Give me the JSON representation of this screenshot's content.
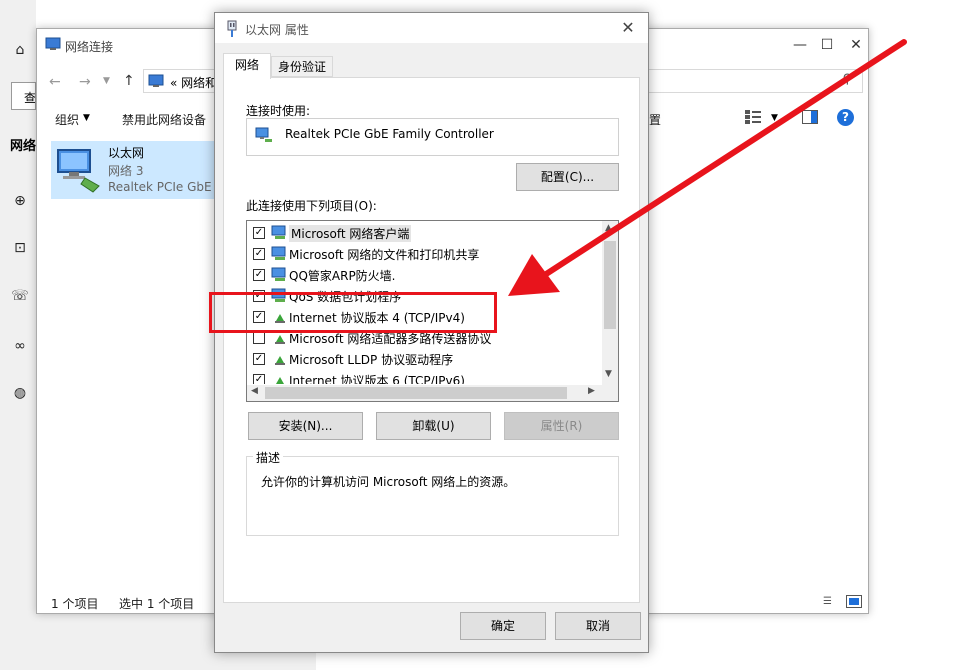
{
  "left_panel": {
    "search_partial": "查",
    "section_label": "网络",
    "icons": [
      "home-icon",
      "globe-network-icon",
      "ethernet-icon",
      "dialup-icon",
      "vpn-icon",
      "web-icon"
    ]
  },
  "explorer": {
    "title": "网络连接",
    "address": "«  网络和",
    "toolbar": {
      "organize": "组织",
      "disable": "禁用此网络设备",
      "right_cmd": "置"
    },
    "adapter": {
      "name": "以太网",
      "network": "网络 3",
      "device": "Realtek PCIe GbE"
    },
    "status": {
      "count": "1 个项目",
      "selected": "选中 1 个项目"
    },
    "window_buttons": {
      "minimize": "—",
      "maximize": "☐",
      "close": "✕"
    }
  },
  "dialog": {
    "title": "以太网 属性",
    "tabs": [
      "网络",
      "身份验证"
    ],
    "connect_using_label": "连接时使用:",
    "adapter_name": "Realtek PCIe GbE Family Controller",
    "configure_button": "配置(C)...",
    "items_label": "此连接使用下列项目(O):",
    "items": [
      {
        "label": "Microsoft 网络客户端",
        "checked": true,
        "icon": "network-client-icon"
      },
      {
        "label": "Microsoft 网络的文件和打印机共享",
        "checked": true,
        "icon": "file-share-icon"
      },
      {
        "label": "QQ管家ARP防火墙.",
        "checked": true,
        "icon": "firewall-icon"
      },
      {
        "label": "QoS 数据包计划程序",
        "checked": true,
        "icon": "qos-icon"
      },
      {
        "label": "Internet 协议版本 4 (TCP/IPv4)",
        "checked": true,
        "icon": "protocol-icon"
      },
      {
        "label": "Microsoft 网络适配器多路传送器协议",
        "checked": false,
        "icon": "protocol-icon"
      },
      {
        "label": "Microsoft LLDP 协议驱动程序",
        "checked": true,
        "icon": "protocol-icon"
      },
      {
        "label": "Internet 协议版本 6 (TCP/IPv6)",
        "checked": true,
        "icon": "protocol-icon"
      }
    ],
    "install_button": "安装(N)...",
    "uninstall_button": "卸载(U)",
    "properties_button": "属性(R)",
    "description_legend": "描述",
    "description_text": "允许你的计算机访问 Microsoft 网络上的资源。",
    "ok_button": "确定",
    "cancel_button": "取消",
    "close_glyph": "✕"
  },
  "annotation": {
    "color": "#e8141c"
  }
}
